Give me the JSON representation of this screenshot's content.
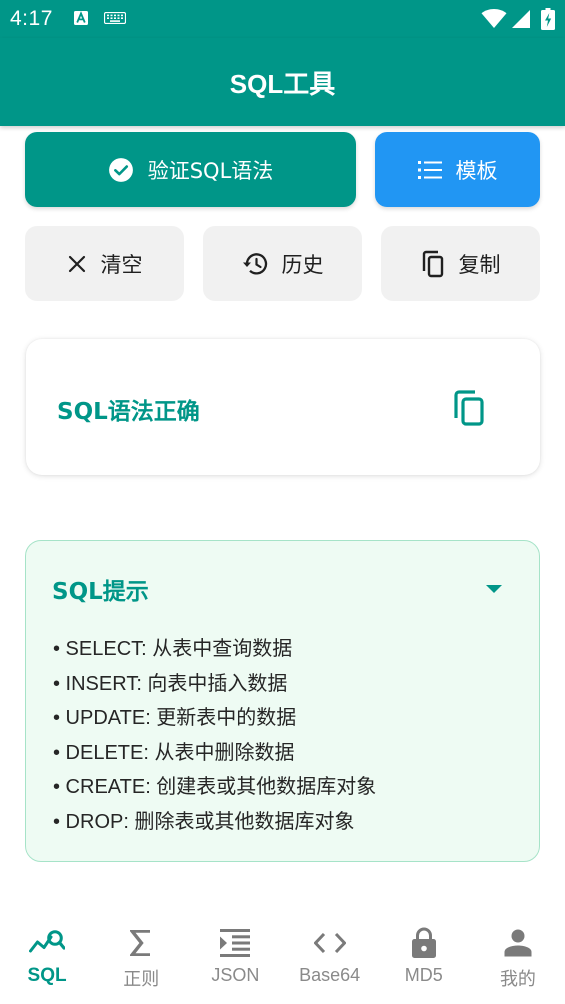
{
  "status_bar": {
    "time": "4:17"
  },
  "app_bar": {
    "title": "SQL工具"
  },
  "actions": {
    "validate_label": "验证SQL语法",
    "template_label": "模板",
    "clear_label": "清空",
    "history_label": "历史",
    "copy_label": "复制"
  },
  "result": {
    "message": "SQL语法正确"
  },
  "tips": {
    "title": "SQL提示",
    "items": [
      "• SELECT: 从表中查询数据",
      "• INSERT: 向表中插入数据",
      "• UPDATE: 更新表中的数据",
      "• DELETE: 从表中删除数据",
      "• CREATE: 创建表或其他数据库对象",
      "• DROP: 删除表或其他数据库对象"
    ]
  },
  "bottom_nav": {
    "items": [
      {
        "label": "SQL",
        "icon": "query-stats-icon",
        "active": true
      },
      {
        "label": "正则",
        "icon": "sigma-icon",
        "active": false
      },
      {
        "label": "JSON",
        "icon": "format-indent-icon",
        "active": false
      },
      {
        "label": "Base64",
        "icon": "code-icon",
        "active": false
      },
      {
        "label": "MD5",
        "icon": "lock-icon",
        "active": false
      },
      {
        "label": "我的",
        "icon": "person-icon",
        "active": false
      }
    ]
  },
  "colors": {
    "primary": "#009688",
    "template_button": "#2196f3",
    "secondary_button": "#f1f1f1",
    "tips_background": "#eefbf3",
    "tips_border": "#a6e3c8",
    "inactive_nav": "#8a8a8a"
  },
  "icons": {
    "validate": "check-circle-icon",
    "template": "list-icon",
    "clear": "close-icon",
    "history": "history-icon",
    "copy": "copy-icon",
    "result_copy": "copy-icon",
    "tips_toggle": "caret-down-icon"
  }
}
